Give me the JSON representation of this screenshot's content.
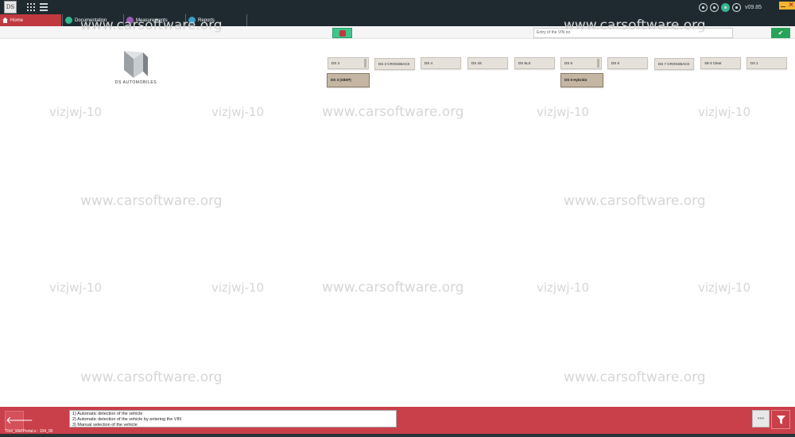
{
  "app": {
    "version": "v09.85",
    "logo_text": "DS"
  },
  "nav": {
    "home": "Home",
    "documentation": "Documentation",
    "measurements": "Measurements",
    "reports": "Reports"
  },
  "toolbar": {
    "vin_placeholder": "Entry of the VIN no"
  },
  "brand": {
    "name": "DS AUTOMOBILES"
  },
  "models": {
    "row1": [
      "DS 3",
      "DS 3 CROSSBACK",
      "DS 4",
      "DS 4S",
      "DS 5LS",
      "DS 5",
      "DS 6",
      "DS 7 CROSSBACK",
      "X8-3 Clear",
      "D4 1"
    ],
    "row2": [
      "DS 3 (X8SP)",
      "DS 5 Hybrid4"
    ]
  },
  "footer": {
    "help_lines": [
      "1) Automatic detection of the vehicle",
      "2) Automatic detection of the vehicle by entering the VIN",
      "3) Manual selection of the vehicle"
    ],
    "tree_label": "Tree_startPortal.s : 104_00",
    "dots": "•••"
  },
  "watermarks": {
    "site": "www.carsoftware.org",
    "tag": "vizjwj-10"
  },
  "colors": {
    "topbar": "#1f2a30",
    "accent_red": "#c9404a",
    "confirm_green": "#2aa35a",
    "model_button": "#e5e1da",
    "model_selected": "#c4b6a3"
  },
  "icons": [
    "grid-icon",
    "list-icon",
    "home-icon",
    "documentation-icon",
    "measurements-icon",
    "reports-icon",
    "vin-scan-icon",
    "check-icon",
    "back-arrow-icon",
    "filter-icon"
  ]
}
